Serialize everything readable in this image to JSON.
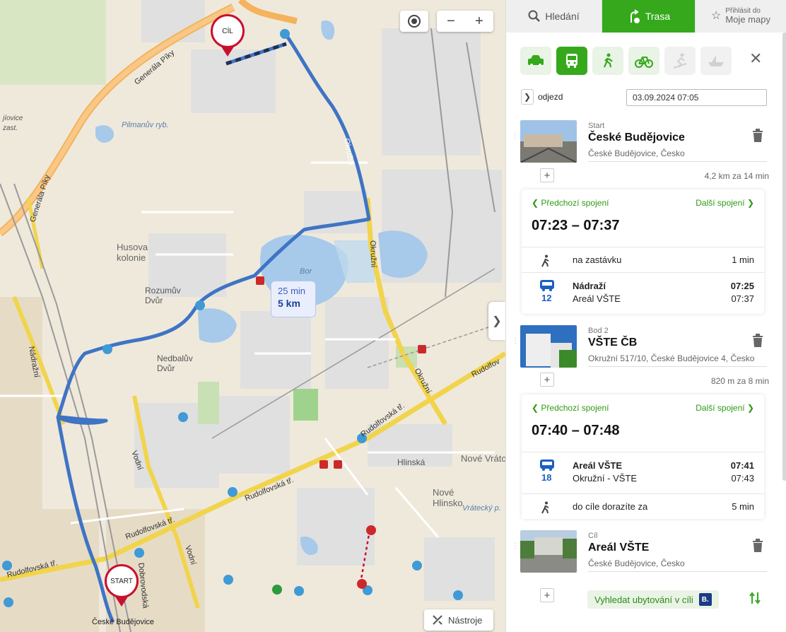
{
  "map": {
    "labels": {
      "pilmanuv": "Pilmanův ryb.",
      "husova": "Husova kolonie",
      "rozumuv": "Rozumův Dvůr",
      "nedbaluv": "Nedbalův Dvůr",
      "bor": "Bor",
      "nove_vratov": "Nové Vrátov",
      "nove_hlinsko": "Nové Hlinsko",
      "hlinska": "Hlinská",
      "vratecky": "Vrátecký p.",
      "jizovice": "jíovice",
      "zast": "zast.",
      "ceske_budejovice": "České Budějovice"
    },
    "roads": {
      "generala_piky_1": "Generála Píky",
      "generala_piky_2": "Generála Píky",
      "okruzni_1": "Okružní",
      "okruzni_2": "Okružní",
      "nadrazni": "Nádražní",
      "vodni_1": "Vodní",
      "vodni_2": "Vodní",
      "dobrovodska": "Dobrovodská",
      "rudolfovska_1": "Rudolfovská tř.",
      "rudolfovska_2": "Rudolfovská tř.",
      "rudolfovska_3": "Rudolfovská tř.",
      "rudolfovska_4": "Rudolfovská tř.",
      "rudolfovska_5": "Rudolfov"
    },
    "pin_finish": "CÍL",
    "pin_start": "START",
    "route_time": "25 min",
    "route_distance": "5 km",
    "tools_label": "Nástroje",
    "colors": {
      "route": "#3f74c4",
      "pin": "#c8102e",
      "water": "#a7c9ea"
    }
  },
  "panel": {
    "tabs": {
      "search": "Hledání",
      "route": "Trasa",
      "login_small": "Přihlásit do",
      "login_big": "Moje mapy"
    },
    "modes": [
      "car-icon",
      "bus-icon",
      "walk-icon",
      "bike-icon",
      "ski-icon",
      "boat-icon"
    ],
    "departure_label": "odjezd",
    "departure_value": "03.09.2024 07:05",
    "stops": [
      {
        "kind": "Start",
        "name": "České Budějovice",
        "addr": "České Budějovice, Česko"
      },
      {
        "kind": "Bod 2",
        "name": "VŠTE ČB",
        "addr": "Okružní 517/10, České Budějovice 4, Česko"
      },
      {
        "kind": "Cíl",
        "name": "Areál VŠTE",
        "addr": "České Budějovice, Česko"
      }
    ],
    "segments": [
      {
        "summary": "4,2 km za 14 min",
        "prev": "Předchozí spojení",
        "next": "Další spojení",
        "times": "07:23 – 07:37",
        "walk": {
          "label": "na zastávku",
          "duration": "1 min"
        },
        "bus": {
          "line": "12",
          "from": "Nádraží",
          "to": "Areál VŠTE",
          "dep": "07:25",
          "arr": "07:37"
        }
      },
      {
        "summary": "820 m za 8 min",
        "prev": "Předchozí spojení",
        "next": "Další spojení",
        "times": "07:40 – 07:48",
        "bus": {
          "line": "18",
          "from": "Areál VŠTE",
          "to": "Okružní - VŠTE",
          "dep": "07:41",
          "arr": "07:43"
        },
        "walk": {
          "label": "do cíle dorazíte za",
          "duration": "5 min"
        }
      }
    ],
    "lodging": "Vyhledat ubytování v cíli",
    "lodging_badge": "B."
  }
}
